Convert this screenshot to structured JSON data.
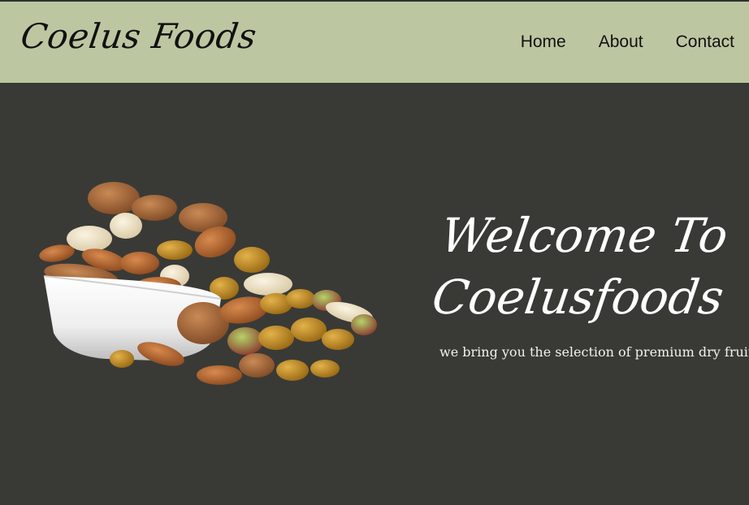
{
  "brand": {
    "name": "Coelus Foods"
  },
  "nav": {
    "items": [
      {
        "label": "Home"
      },
      {
        "label": "About"
      },
      {
        "label": "Contact"
      }
    ]
  },
  "hero": {
    "heading_line1": "Welcome To",
    "heading_line2": "Coelusfoods",
    "tagline": "we bring you the selection of premium dry fruits.",
    "image_alt": "dry-fruits-bowl"
  },
  "colors": {
    "navbar_bg": "#bcc7a1",
    "page_bg": "#393a36",
    "heading_text": "#ffffff",
    "nav_text": "#111111"
  }
}
